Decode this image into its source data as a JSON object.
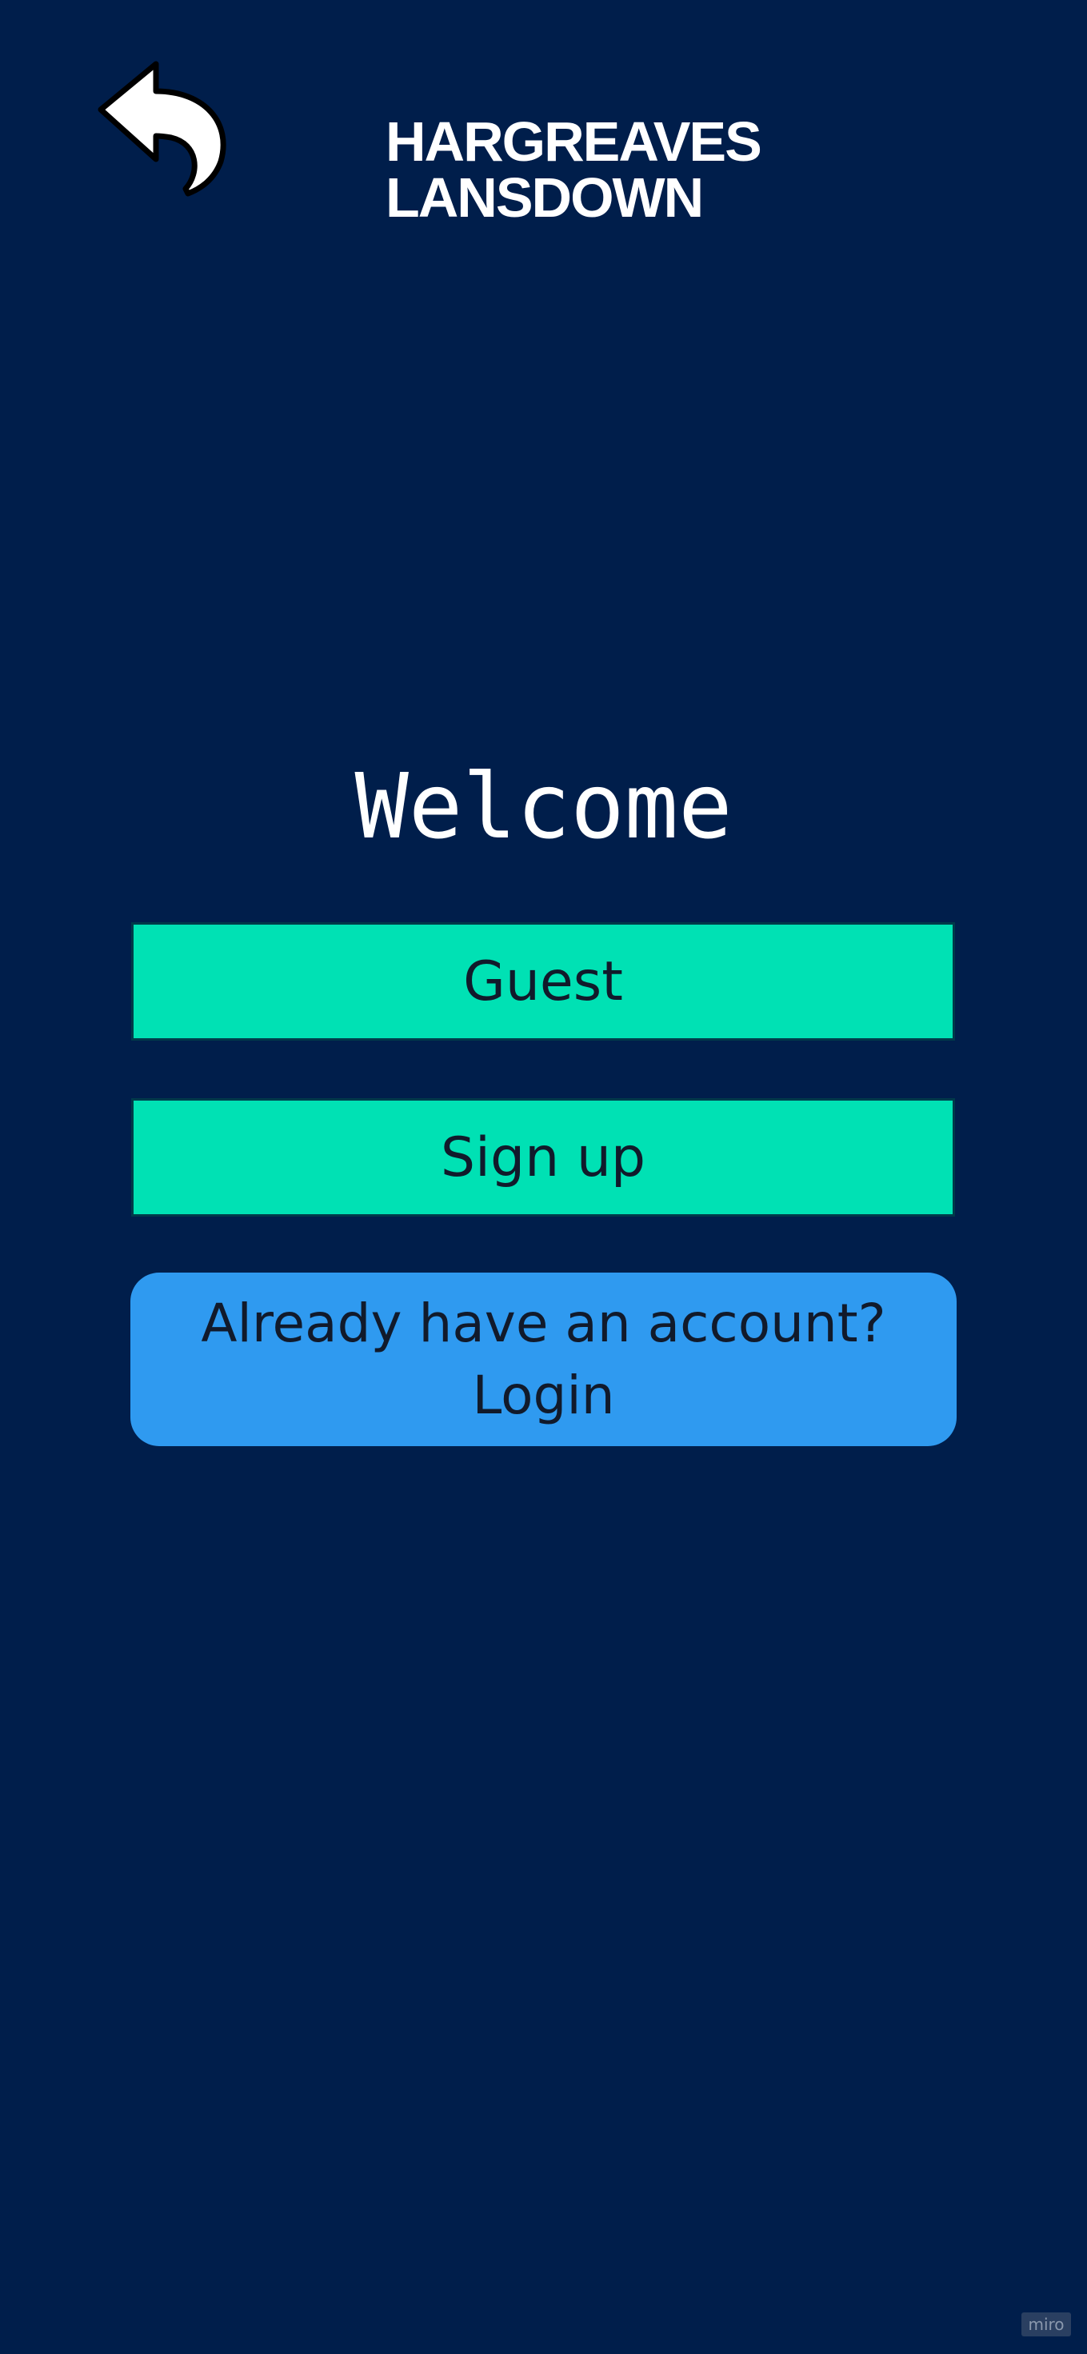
{
  "colors": {
    "background": "#001e4b",
    "primary_button": "#00e1b4",
    "secondary_button": "#2f9af0",
    "text_dark": "#111a2b",
    "text_light": "#ffffff"
  },
  "header": {
    "back_icon": "back-arrow-icon",
    "logo_line1": "HARGREAVES",
    "logo_line2": "LANSDOWN"
  },
  "main": {
    "title": "Welcome",
    "guest_label": "Guest",
    "signup_label": "Sign up",
    "login_line1": "Already have an account?",
    "login_line2": "Login"
  },
  "footer": {
    "watermark": "miro"
  }
}
